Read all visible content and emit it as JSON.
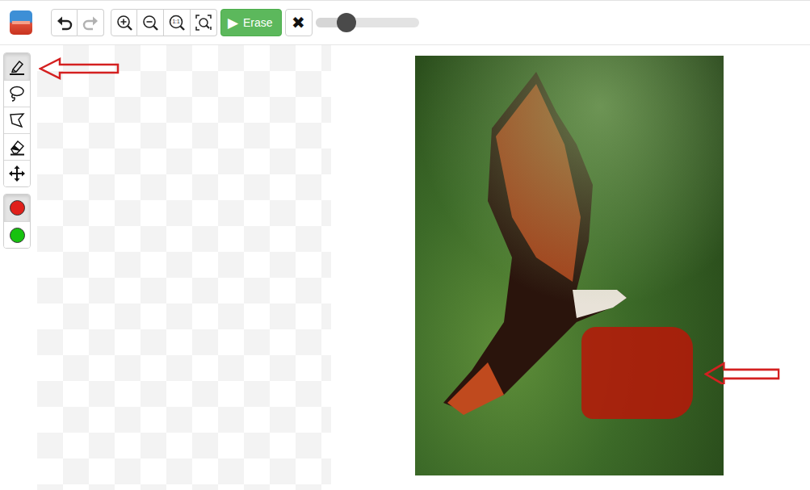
{
  "toolbar": {
    "history": [
      {
        "kind": "undo",
        "disabled": false
      },
      {
        "kind": "redo",
        "disabled": true
      }
    ],
    "zoom": [
      {
        "kind": "zoom-in",
        "label": ""
      },
      {
        "kind": "zoom-out",
        "label": ""
      },
      {
        "kind": "actual-size",
        "label": "1:1"
      },
      {
        "kind": "fit",
        "label": ""
      }
    ],
    "erase_button": {
      "icon": "▶",
      "label": "Erase"
    },
    "clear_button": {
      "icon": "✖"
    },
    "brush_size": {
      "level": 0.3
    }
  },
  "tools": [
    {
      "kind": "brush",
      "selected": true
    },
    {
      "kind": "lasso",
      "selected": false
    },
    {
      "kind": "polygon",
      "selected": false
    },
    {
      "kind": "eraser",
      "selected": false
    },
    {
      "kind": "move",
      "selected": false
    }
  ],
  "colors": [
    {
      "color": "#e0201b",
      "selected": true
    },
    {
      "color": "#17c20f",
      "selected": false
    }
  ]
}
